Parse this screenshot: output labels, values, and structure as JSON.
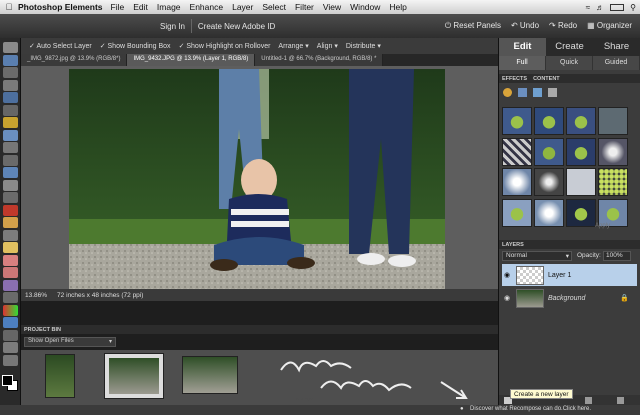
{
  "menubar": {
    "app_name": "Photoshop Elements",
    "items": [
      "File",
      "Edit",
      "Image",
      "Enhance",
      "Layer",
      "Select",
      "Filter",
      "View",
      "Window",
      "Help"
    ]
  },
  "topbar": {
    "sign_in": "Sign In",
    "create_id": "Create New Adobe ID",
    "reset_panels": "Reset Panels",
    "undo": "Undo",
    "redo": "Redo",
    "organizer": "Organizer"
  },
  "options": {
    "auto_select": "Auto Select Layer",
    "bounding_box": "Show Bounding Box",
    "highlight": "Show Highlight on Rollover",
    "arrange": "Arrange",
    "align": "Align",
    "distribute": "Distribute"
  },
  "tabs": [
    "_IMG_9872.jpg @ 13.9% (RGB/8*)",
    "IMG_9432.JPG @ 13.9% (Layer 1, RGB/8)",
    "Untitled-1 @ 66.7% (Background, RGB/8) *"
  ],
  "status": {
    "zoom": "13.86%",
    "size": "72 inches x 48 inches (72 ppi)"
  },
  "project_bin": {
    "title": "PROJECT BIN",
    "select": "Show Open Files"
  },
  "right_panel": {
    "modes": [
      "Edit",
      "Create",
      "Share"
    ],
    "submodes": [
      "Full",
      "Quick",
      "Guided"
    ],
    "effects_tabs": [
      "EFFECTS",
      "CONTENT"
    ],
    "apply_label": "Apply",
    "layers_title": "LAYERS",
    "blend_mode": "Normal",
    "opacity_label": "Opacity:",
    "opacity_value": "100%",
    "layers": [
      {
        "name": "Layer 1",
        "selected": true
      },
      {
        "name": "Background",
        "selected": false
      }
    ]
  },
  "tooltip": "Create a new layer",
  "annotation_handwritten": "new layer",
  "bottom_tip": "Discover what Recompose can do.Click here.",
  "colors": {
    "accent": "#7a9cc9",
    "selected_layer": "#b8d0ea"
  }
}
